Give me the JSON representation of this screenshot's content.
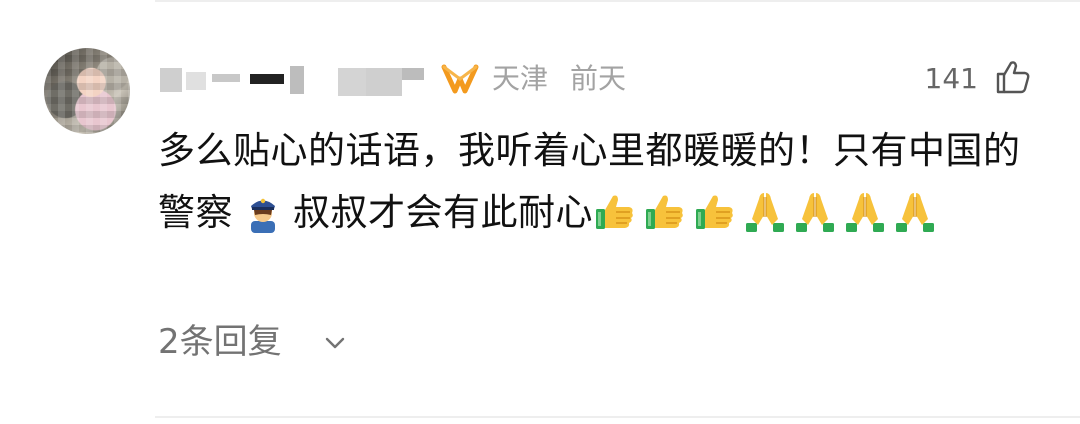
{
  "comment": {
    "location": "天津",
    "time": "前天",
    "likes": "141",
    "text_part1": "多么贴心的话语，我听着心里都暖暖的！只有中国的警察",
    "text_part2": "叔叔才会有此耐心",
    "emoji_sequence": [
      "thumbs-up",
      "thumbs-up",
      "thumbs-up",
      "folded-hands",
      "folded-hands",
      "folded-hands",
      "folded-hands"
    ],
    "replies_label": "2条回复"
  },
  "colors": {
    "meta_gray": "#a3a3a3",
    "vip_orange": "#f39a1e",
    "emoji_yellow": "#f7c23b",
    "emoji_green": "#2faa53"
  }
}
